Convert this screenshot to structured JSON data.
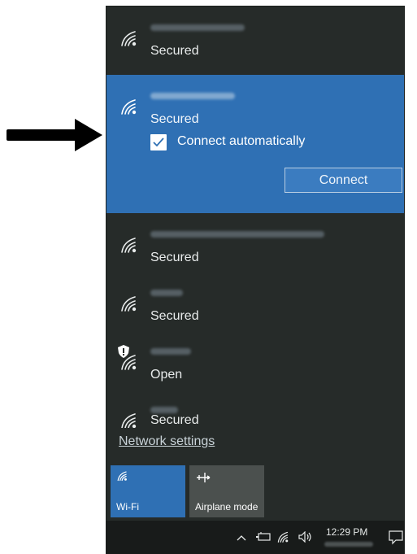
{
  "networks": [
    {
      "status": "Secured",
      "selected": false
    },
    {
      "status": "Secured",
      "selected": true
    },
    {
      "status": "Secured",
      "selected": false
    },
    {
      "status": "Secured",
      "selected": false
    },
    {
      "status": "Open",
      "selected": false
    },
    {
      "status": "Secured",
      "selected": false
    }
  ],
  "selected_network": {
    "connect_automatically_label": "Connect automatically",
    "connect_automatically_checked": true,
    "connect_button_label": "Connect"
  },
  "network_settings_link": "Network settings",
  "quick_actions": [
    {
      "label": "Wi-Fi",
      "icon": "wifi-icon",
      "active": true
    },
    {
      "label": "Airplane mode",
      "icon": "airplane-icon",
      "active": false
    }
  ],
  "taskbar": {
    "time": "12:29 PM",
    "icons": [
      "chevron-up-icon",
      "battery-icon",
      "wifi-icon",
      "speaker-icon",
      "action-center-icon"
    ]
  },
  "colors": {
    "panel_bg": "#262b29",
    "accent": "#2f70b4",
    "taskbar_bg": "#181b1a",
    "arrow": "#000000"
  }
}
